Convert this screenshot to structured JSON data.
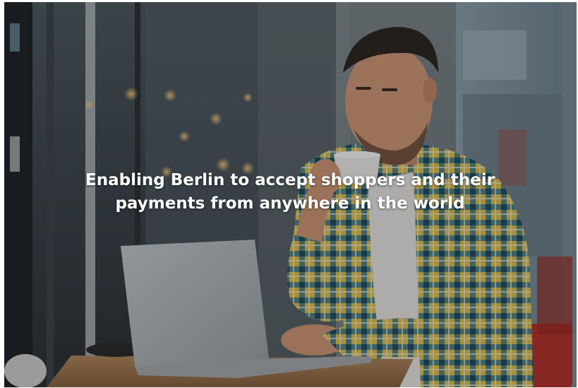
{
  "hero": {
    "headline_line1": "Enabling Berlin to accept shoppers and their",
    "headline_line2": "payments from anywhere in the world"
  },
  "photo": {
    "subject": "man-drinking-coffee-at-laptop",
    "shirt_colors": [
      "#e2c24a",
      "#2f6f86",
      "#f0e6c8"
    ],
    "overlay_color": "#0a0c0e"
  }
}
